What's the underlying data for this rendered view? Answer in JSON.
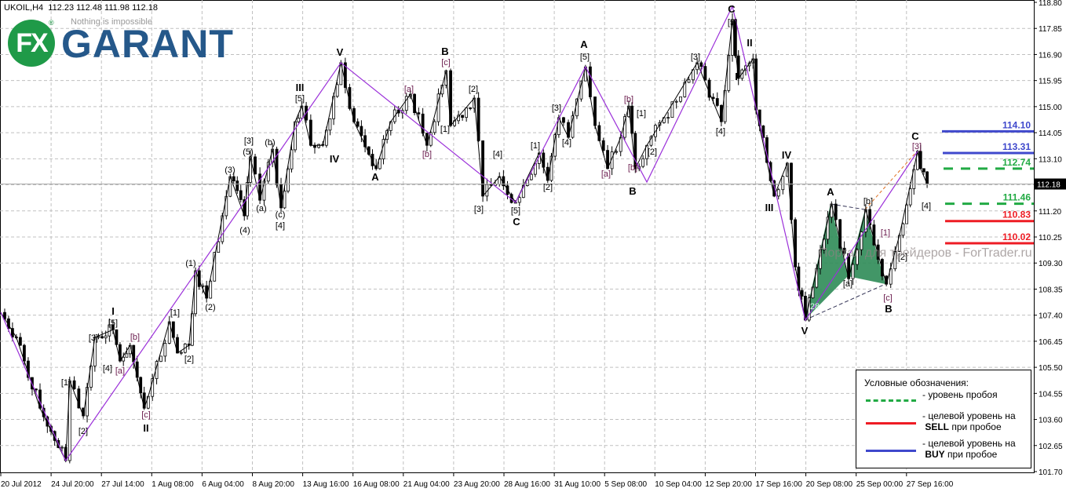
{
  "header": {
    "symbol": "UKOIL,H4",
    "ohlc": "112.23 112.48 111.98 112.18"
  },
  "logo": {
    "mark": "FX",
    "brand": "GARANT",
    "tagline": "Nothing is impossible",
    "registered": "®"
  },
  "watermark": "Портал для трейдеров - ForTrader.ru",
  "legend": {
    "title": "Условные обозначения:",
    "items": [
      {
        "text1": "- уровень пробоя",
        "text2": "",
        "bold": "",
        "style": "dashed",
        "color": "#22aa44"
      },
      {
        "text1": "- целевой уровень на",
        "bold": "SELL",
        "text2": " при пробое",
        "style": "solid",
        "color": "#ee1c24"
      },
      {
        "text1": "- целевой уровень на",
        "bold": "BUY",
        "text2": " при пробое",
        "style": "solid",
        "color": "#3f48cc"
      }
    ]
  },
  "chart_data": {
    "type": "line",
    "title": "UKOIL,H4",
    "ylim": [
      101.7,
      118.8
    ],
    "yticks": [
      "118.80",
      "117.85",
      "116.90",
      "115.95",
      "115.00",
      "114.05",
      "113.10",
      "112.15",
      "111.20",
      "110.25",
      "109.30",
      "108.35",
      "107.40",
      "106.45",
      "105.50",
      "104.55",
      "103.60",
      "102.65",
      "101.70"
    ],
    "xticks": [
      "20 Jul 2012",
      "24 Jul 20:00",
      "27 Jul 14:00",
      "1 Aug 08:00",
      "6 Aug 04:00",
      "8 Aug 20:00",
      "13 Aug 16:00",
      "16 Aug 08:00",
      "21 Aug 04:00",
      "23 Aug 20:00",
      "28 Aug 16:00",
      "31 Aug 10:00",
      "5 Sep 08:00",
      "10 Sep 04:00",
      "12 Sep 20:00",
      "17 Sep 16:00",
      "20 Sep 08:00",
      "25 Sep 00:00",
      "27 Sep 16:00"
    ],
    "x_unit": "x-tick index",
    "current_price": "112.18",
    "price_pivots": [
      [
        0,
        107.5
      ],
      [
        0.31,
        106.59
      ],
      [
        0.78,
        104.01
      ],
      [
        1.29,
        102.1
      ],
      [
        1.37,
        105.01
      ],
      [
        1.64,
        103.73
      ],
      [
        1.87,
        106.59
      ],
      [
        2.23,
        106.87
      ],
      [
        2.37,
        105.73
      ],
      [
        2.57,
        106.3
      ],
      [
        2.85,
        104.01
      ],
      [
        2.93,
        104.44
      ],
      [
        3.35,
        107.16
      ],
      [
        3.51,
        106.02
      ],
      [
        3.74,
        106.3
      ],
      [
        3.87,
        109.02
      ],
      [
        4.09,
        108.02
      ],
      [
        4.56,
        112.45
      ],
      [
        4.84,
        111.02
      ],
      [
        4.96,
        113.17
      ],
      [
        5.15,
        111.59
      ],
      [
        5.4,
        113.45
      ],
      [
        5.57,
        111.31
      ],
      [
        5.85,
        114.45
      ],
      [
        5.98,
        115.02
      ],
      [
        6.16,
        113.59
      ],
      [
        6.4,
        113.59
      ],
      [
        6.76,
        116.6
      ],
      [
        7.02,
        114.45
      ],
      [
        7.46,
        112.74
      ],
      [
        7.75,
        114.45
      ],
      [
        8.14,
        115.45
      ],
      [
        8.47,
        113.59
      ],
      [
        8.85,
        116.31
      ],
      [
        8.94,
        114.31
      ],
      [
        9.41,
        115.31
      ],
      [
        9.58,
        111.74
      ],
      [
        9.91,
        112.45
      ],
      [
        10.23,
        111.51
      ],
      [
        10.7,
        113.31
      ],
      [
        10.87,
        112.31
      ],
      [
        11.09,
        114.6
      ],
      [
        11.28,
        113.88
      ],
      [
        11.62,
        116.45
      ],
      [
        11.81,
        114.31
      ],
      [
        12.06,
        112.74
      ],
      [
        12.32,
        113.88
      ],
      [
        12.48,
        115.02
      ],
      [
        12.61,
        112.74
      ],
      [
        12.84,
        113.59
      ],
      [
        13.18,
        114.6
      ],
      [
        13.84,
        116.6
      ],
      [
        14.32,
        114.45
      ],
      [
        14.54,
        118.17
      ],
      [
        14.66,
        116.03
      ],
      [
        14.95,
        116.74
      ],
      [
        15.01,
        114.88
      ],
      [
        15.37,
        111.74
      ],
      [
        15.63,
        112.94
      ],
      [
        15.79,
        109.16
      ],
      [
        15.99,
        107.22
      ],
      [
        16.51,
        111.45
      ],
      [
        16.85,
        108.73
      ],
      [
        17.19,
        111.25
      ],
      [
        17.6,
        108.53
      ],
      [
        17.86,
        110.31
      ],
      [
        18.22,
        113.37
      ],
      [
        18.28,
        112.74
      ],
      [
        18.41,
        112.18
      ]
    ],
    "wave_line": [
      [
        0,
        107.5
      ],
      [
        1.29,
        102.1
      ],
      [
        6.76,
        116.6
      ],
      [
        10.23,
        111.51
      ],
      [
        11.62,
        116.45
      ],
      [
        12.84,
        112.25
      ],
      [
        14.54,
        118.66
      ],
      [
        15.99,
        107.22
      ],
      [
        18.22,
        113.37
      ]
    ],
    "levels": [
      {
        "value": "114.10",
        "color": "#3f48cc",
        "style": "solid"
      },
      {
        "value": "113.31",
        "color": "#3f48cc",
        "style": "solid"
      },
      {
        "value": "112.74",
        "color": "#22aa44",
        "style": "dashed"
      },
      {
        "value": "111.46",
        "color": "#22aa44",
        "style": "dashed"
      },
      {
        "value": "110.83",
        "color": "#ee1c24",
        "style": "solid"
      },
      {
        "value": "110.02",
        "color": "#ee1c24",
        "style": "solid"
      }
    ],
    "wave_labels_major": [
      "I",
      "II",
      "III",
      "IV",
      "V",
      "A",
      "B",
      "C",
      "A",
      "B",
      "C",
      "II",
      "I",
      "III",
      "IV",
      "V",
      "A",
      "B",
      "C"
    ],
    "wave_labels_minor": [
      "[1]",
      "[2]",
      "[3]",
      "[5]",
      "[4]",
      "[a]",
      "[b]",
      "[c]",
      "[1]",
      "[2]",
      "(1)",
      "(2)",
      "(3)",
      "(4)",
      "[3]",
      "(5)",
      "(b)",
      "(a)",
      "(c)",
      "[4]",
      "[5]",
      "[a]",
      "[c]",
      "[b]",
      "[1]",
      "[2]",
      "[3]",
      "[4]",
      "[5]",
      "[1]",
      "[2]",
      "[3]",
      "[4]",
      "[5]",
      "[a]",
      "[b]",
      "[b]",
      "[1]",
      "[2]",
      "[3]",
      "[4]",
      "[5]",
      "[a]",
      "[b]",
      "[1]",
      "[2]",
      "[c]",
      "[3]",
      "[4]",
      "28"
    ]
  }
}
